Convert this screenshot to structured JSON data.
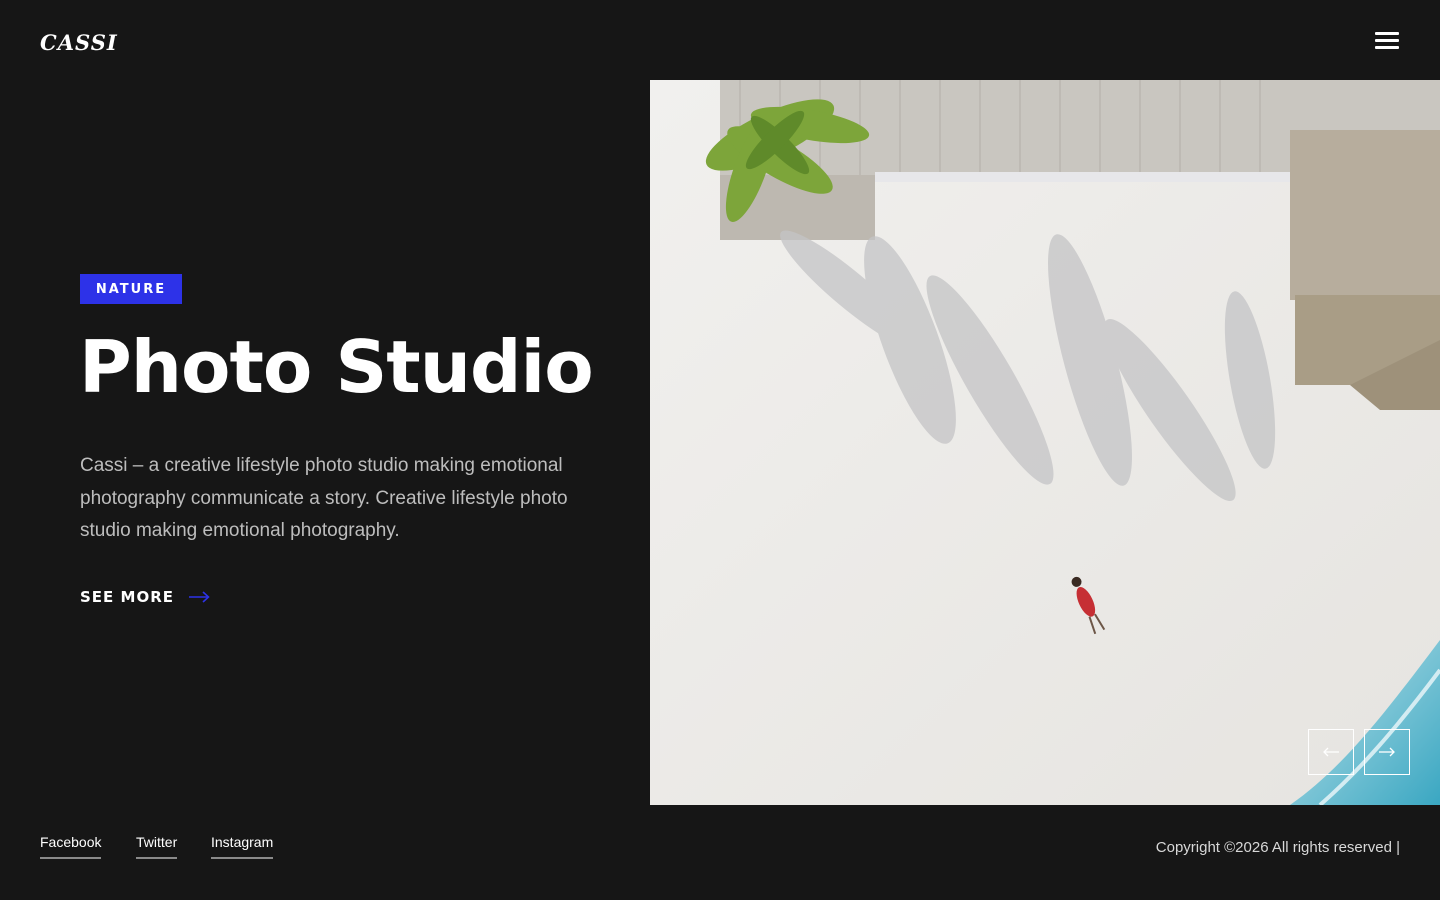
{
  "header": {
    "logo": "CASSI",
    "menu_icon": "hamburger-menu-icon"
  },
  "hero": {
    "tag": "NATURE",
    "title": "Photo Studio",
    "description": "Cassi – a creative lifestyle photo studio making emotional photography communicate a story. Creative lifestyle photo studio making emotional photography.",
    "cta_label": "SEE MORE",
    "cta_icon": "arrow-right-icon",
    "image": "aerial-beach-photo",
    "prev_icon": "arrow-left-icon",
    "next_icon": "arrow-right-icon"
  },
  "footer": {
    "social": [
      "Facebook",
      "Twitter",
      "Instagram"
    ],
    "copyright": "Copyright ©2026 All rights reserved |"
  },
  "colors": {
    "background": "#161616",
    "accent": "#2d32e8",
    "text": "#ffffff"
  }
}
